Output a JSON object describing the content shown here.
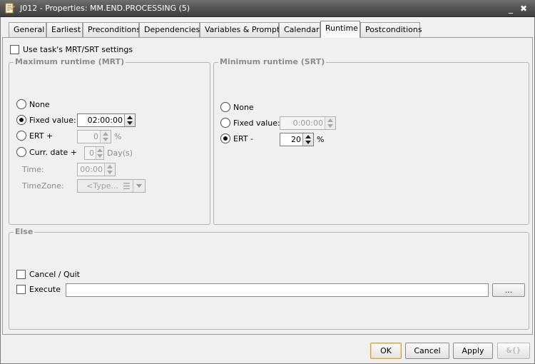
{
  "window": {
    "title": "J012 - Properties: MM.END.PROCESSING (5)",
    "minimize_glyph": "_",
    "close_glyph": "✖"
  },
  "tabs": [
    {
      "label": "General"
    },
    {
      "label": "Earliest"
    },
    {
      "label": "Preconditions"
    },
    {
      "label": "Dependencies"
    },
    {
      "label": "Variables & Prompts"
    },
    {
      "label": "Calendar"
    },
    {
      "label": "Runtime",
      "active": true
    },
    {
      "label": "Postconditions"
    }
  ],
  "runtime": {
    "use_task_settings": {
      "label": "Use task's MRT/SRT settings",
      "checked": false
    },
    "mrt": {
      "title": "Maximum runtime (MRT)",
      "none_label": "None",
      "fixed_label": "Fixed value:",
      "fixed_value": "02:00:00",
      "ert_label": "ERT +",
      "ert_value": "0",
      "ert_unit": "%",
      "curr_date_label": "Curr. date +",
      "curr_date_value": "0",
      "curr_date_unit": "Day(s)",
      "time_label": "Time:",
      "time_value": "00:00",
      "timezone_label": "TimeZone:",
      "timezone_placeholder": "<Type...",
      "selected": "fixed"
    },
    "srt": {
      "title": "Minimum runtime (SRT)",
      "none_label": "None",
      "fixed_label": "Fixed value:",
      "fixed_value": "0:00:00",
      "ert_label": "ERT -",
      "ert_value": "20",
      "ert_unit": "%",
      "selected": "ert"
    },
    "else": {
      "title": "Else",
      "cancel_label": "Cancel / Quit",
      "cancel_checked": false,
      "execute_label": "Execute",
      "execute_checked": false,
      "execute_value": "",
      "browse_label": "..."
    }
  },
  "footer": {
    "ok_label": "OK",
    "cancel_label": "Cancel",
    "apply_label": "Apply",
    "extra_icon_glyph": "&{}"
  },
  "icons": {
    "app": "properties-doc-icon",
    "list": "list-icon"
  }
}
